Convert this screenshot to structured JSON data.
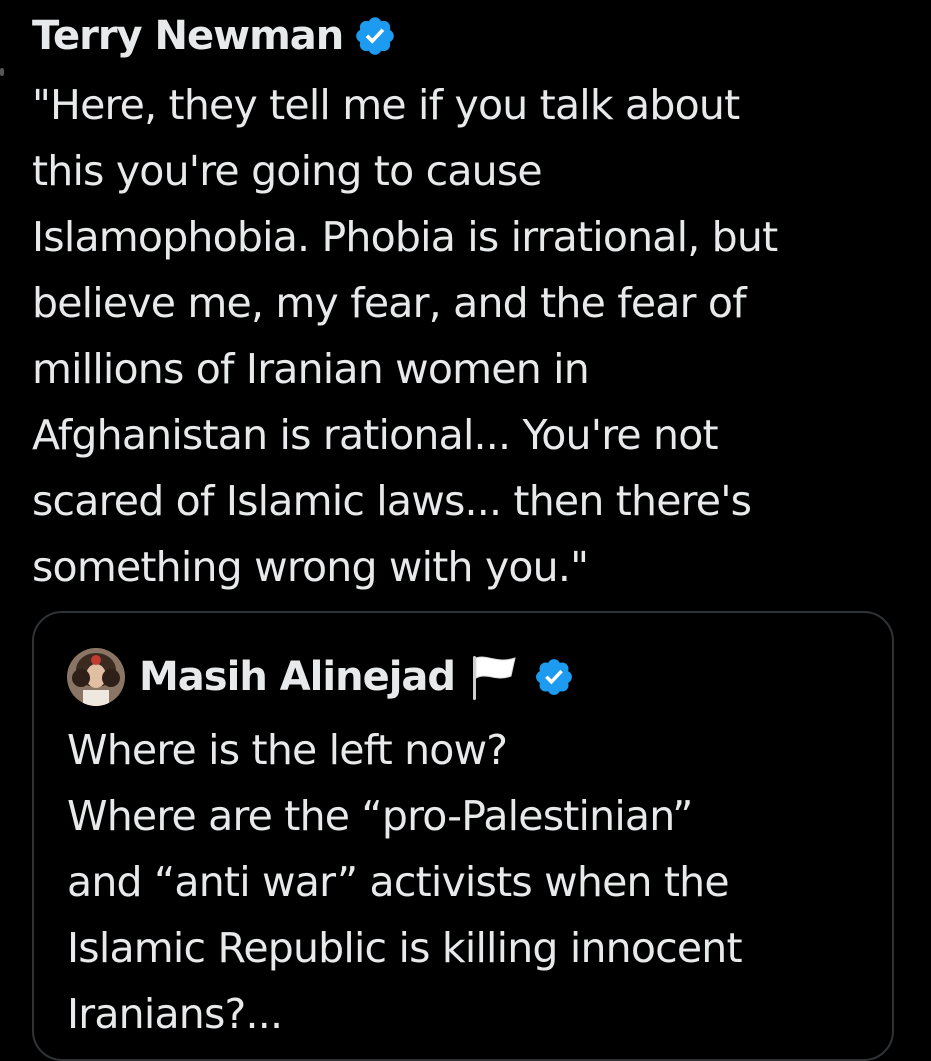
{
  "main_tweet": {
    "author": {
      "display_name": "Terry Newman",
      "verified_icon": "verified-badge-icon",
      "badge_color": "#1d9bf0"
    },
    "text": "\"Here, they tell me if you talk about\nthis you're going to cause\nIslamophobia. Phobia is irrational, but\nbelieve me, my fear, and the fear of\nmillions of Iranian women in\nAfghanistan is rational... You're not\nscared of Islamic laws... then there's\nsomething wrong with you.\""
  },
  "quoted_tweet": {
    "author": {
      "display_name": "Masih Alinejad",
      "avatar_icon": "avatar",
      "flag_icon": "white-flag-icon",
      "verified_icon": "verified-badge-icon",
      "badge_color": "#1d9bf0"
    },
    "text": "Where is the left now?\nWhere are the “pro-Palestinian”\nand “anti war” activists when the\nIslamic Republic is killing innocent\nIranians?..."
  },
  "colors": {
    "background": "#000000",
    "text": "#e7e9ea",
    "border": "#2f3336",
    "accent": "#1d9bf0"
  }
}
